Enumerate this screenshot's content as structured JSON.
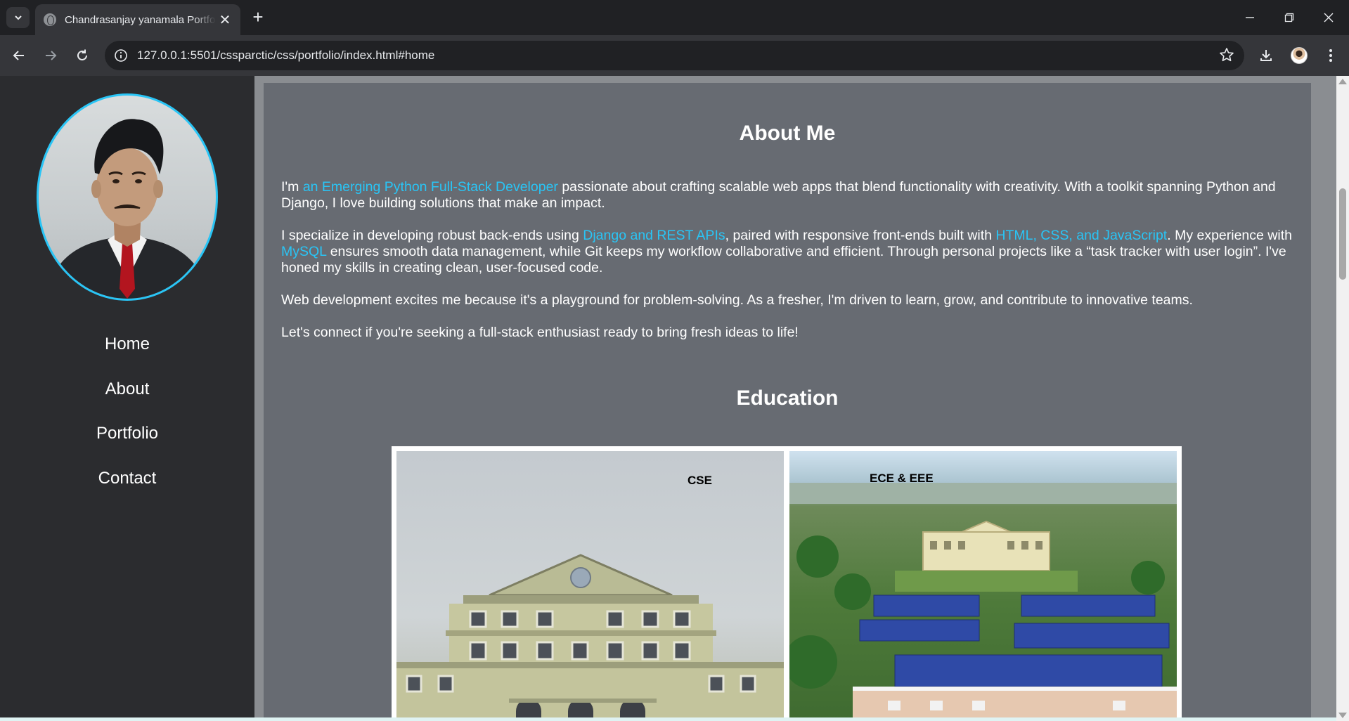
{
  "browser": {
    "tab_title": "Chandrasanjay yanamala Portfolio",
    "url": "127.0.0.1:5501/cssparctic/css/portfolio/index.html#home"
  },
  "sidebar": {
    "nav": [
      {
        "label": "Home"
      },
      {
        "label": "About"
      },
      {
        "label": "Portfolio"
      },
      {
        "label": "Contact"
      }
    ]
  },
  "about": {
    "title": "About Me",
    "p1_a": "I'm ",
    "p1_hl": "an Emerging Python Full-Stack Developer",
    "p1_b": " passionate about crafting scalable web apps that blend functionality with creativity. With a toolkit spanning Python and Django, I love building solutions that make an impact.",
    "p2_a": "I specialize in developing robust back-ends using ",
    "p2_hl1": "Django and REST APIs",
    "p2_b": ", paired with responsive front-ends built with ",
    "p2_hl2": "HTML, CSS, and JavaScript",
    "p2_c": ". My experience with ",
    "p2_hl3": "MySQL",
    "p2_d": " ensures smooth data management, while Git keeps my workflow collaborative and efficient. Through personal projects like a “task tracker with user login”. I've honed my skills in creating clean, user-focused code.",
    "p3": "Web development excites me because it's a playground for problem-solving. As a fresher, I'm driven to learn, grow, and contribute to innovative teams.",
    "p4": "Let's connect if you're seeking a full-stack enthusiast ready to bring fresh ideas to life!"
  },
  "education": {
    "title": "Education",
    "images": [
      {
        "label": "CSE"
      },
      {
        "label": "ECE & EEE"
      }
    ]
  },
  "colors": {
    "accent": "#29c5f6",
    "sidebar_bg": "#2b2c2f",
    "content_bg": "#676b72"
  },
  "icons": [
    "tab-search-icon",
    "globe-icon",
    "close-icon",
    "plus-icon",
    "minimize-icon",
    "maximize-icon",
    "back-arrow-icon",
    "forward-arrow-icon",
    "reload-icon",
    "info-icon",
    "star-icon",
    "download-icon",
    "kebab-menu-icon"
  ]
}
